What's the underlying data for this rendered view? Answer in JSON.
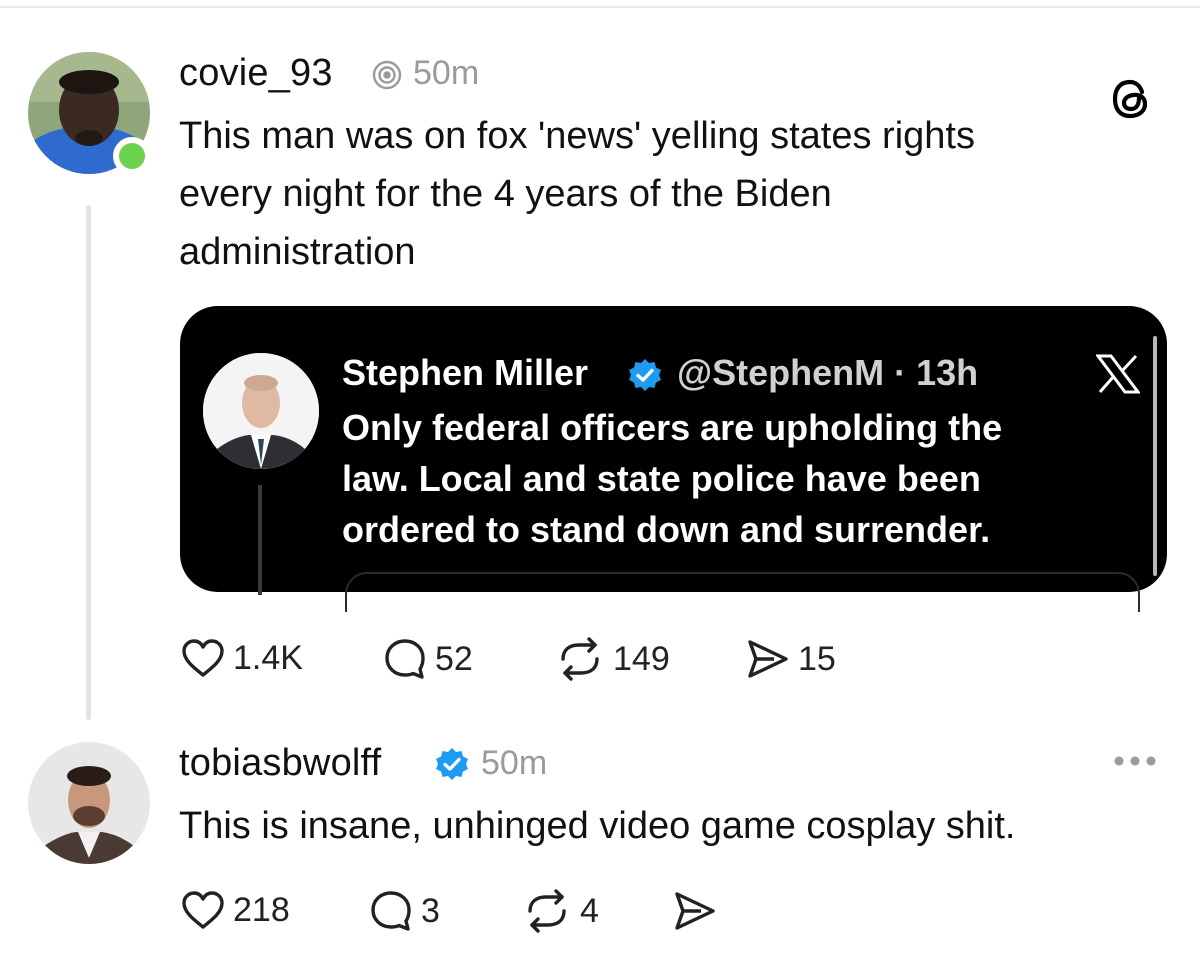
{
  "posts": [
    {
      "username": "covie_93",
      "time": "50m",
      "text_lines": [
        "This man was on fox 'news' yelling states rights",
        "every night for the 4 years of the Biden",
        "administration"
      ],
      "embed": {
        "author_name": "Stephen Miller",
        "handle_time": "@StephenM · 13h",
        "source_logo": "X",
        "body_lines": [
          "Only federal officers are upholding the",
          "law. Local and state police have been",
          "ordered to stand down and surrender."
        ]
      },
      "actions": {
        "likes": "1.4K",
        "replies": "52",
        "reposts": "149",
        "shares": "15"
      }
    },
    {
      "username": "tobiasbwolff",
      "time": "50m",
      "verified": true,
      "text": "This is insane, unhinged video game cosplay shit.",
      "actions": {
        "likes": "218",
        "replies": "3",
        "reposts": "4"
      }
    }
  ],
  "colors": {
    "online": "#6ad24f",
    "verified": "#1d9bf0",
    "secondary_text": "#9a9a9a",
    "embed_bg": "#000000"
  },
  "icons": {
    "app": "threads-logo-icon",
    "menu": "more-options-icon",
    "like": "heart-icon",
    "reply": "comment-bubble-icon",
    "repost": "repost-arrows-icon",
    "share": "send-icon"
  }
}
